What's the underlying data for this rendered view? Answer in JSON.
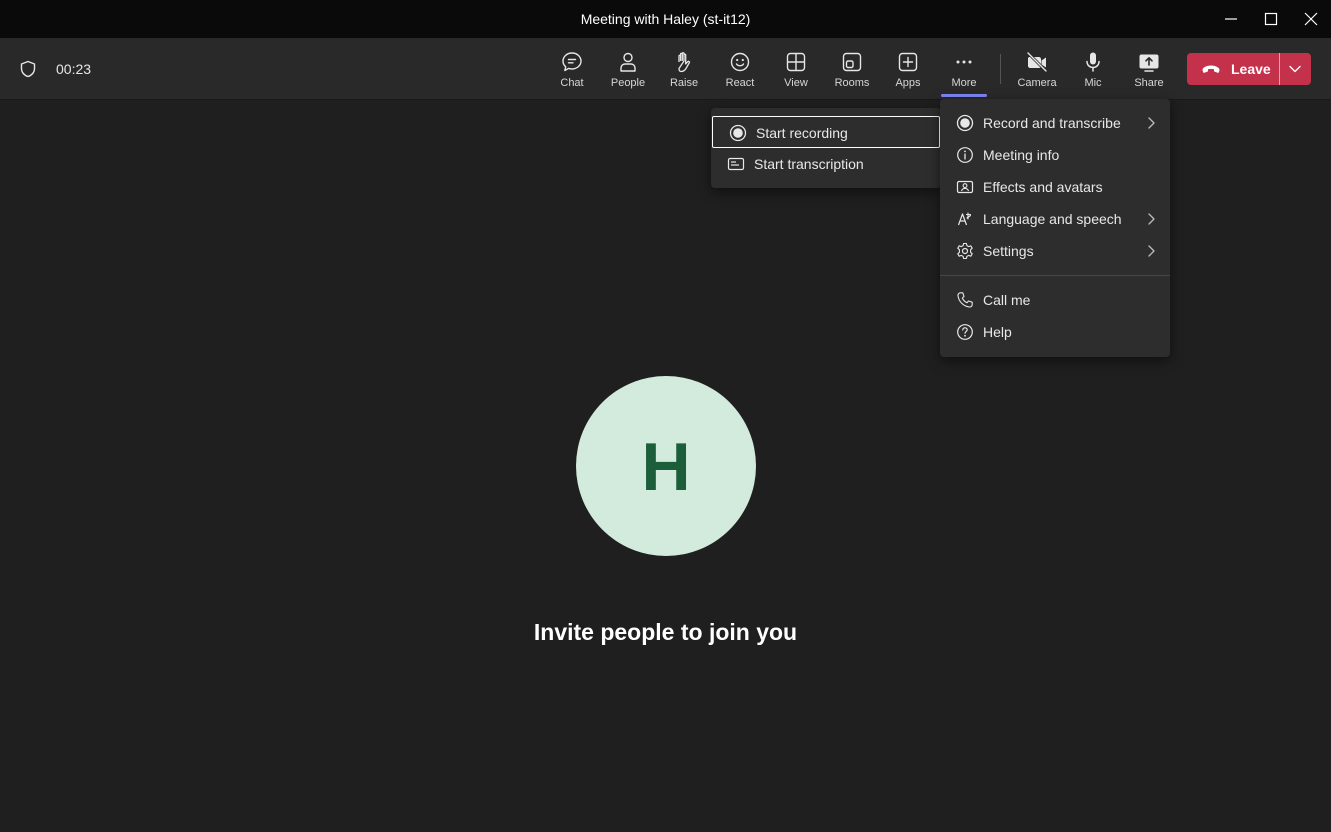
{
  "window": {
    "title": "Meeting with Haley (st-it12)",
    "controls": [
      "minimize-icon",
      "maximize-icon",
      "close-icon"
    ]
  },
  "toolbar": {
    "timer": "00:23",
    "buttons": [
      {
        "label": "Chat",
        "icon": "chat-icon"
      },
      {
        "label": "People",
        "icon": "people-icon"
      },
      {
        "label": "Raise",
        "icon": "raise-hand-icon"
      },
      {
        "label": "React",
        "icon": "react-icon"
      },
      {
        "label": "View",
        "icon": "view-icon"
      },
      {
        "label": "Rooms",
        "icon": "rooms-icon"
      },
      {
        "label": "Apps",
        "icon": "apps-icon"
      },
      {
        "label": "More",
        "icon": "more-icon"
      },
      {
        "label": "Camera",
        "icon": "camera-off-icon"
      },
      {
        "label": "Mic",
        "icon": "mic-icon"
      },
      {
        "label": "Share",
        "icon": "share-icon"
      }
    ],
    "leave_label": "Leave",
    "accent": "#7f85f5",
    "leave_color": "#c4314b"
  },
  "more_menu": {
    "items": [
      {
        "label": "Record and transcribe",
        "icon": "record-icon",
        "has_submenu": true
      },
      {
        "label": "Meeting info",
        "icon": "info-icon",
        "has_submenu": false
      },
      {
        "label": "Effects and avatars",
        "icon": "effects-icon",
        "has_submenu": false
      },
      {
        "label": "Language and speech",
        "icon": "language-icon",
        "has_submenu": true
      },
      {
        "label": "Settings",
        "icon": "gear-icon",
        "has_submenu": true
      },
      {
        "label": "Call me",
        "icon": "phone-icon",
        "has_submenu": false
      },
      {
        "label": "Help",
        "icon": "help-icon",
        "has_submenu": false
      }
    ]
  },
  "record_submenu": {
    "items": [
      {
        "label": "Start recording",
        "icon": "record-icon"
      },
      {
        "label": "Start transcription",
        "icon": "transcript-icon"
      }
    ]
  },
  "stage": {
    "avatar_initial": "H",
    "avatar_bg": "#d3ebdd",
    "avatar_fg": "#1c5e3a",
    "invite_text": "Invite people to join you"
  }
}
